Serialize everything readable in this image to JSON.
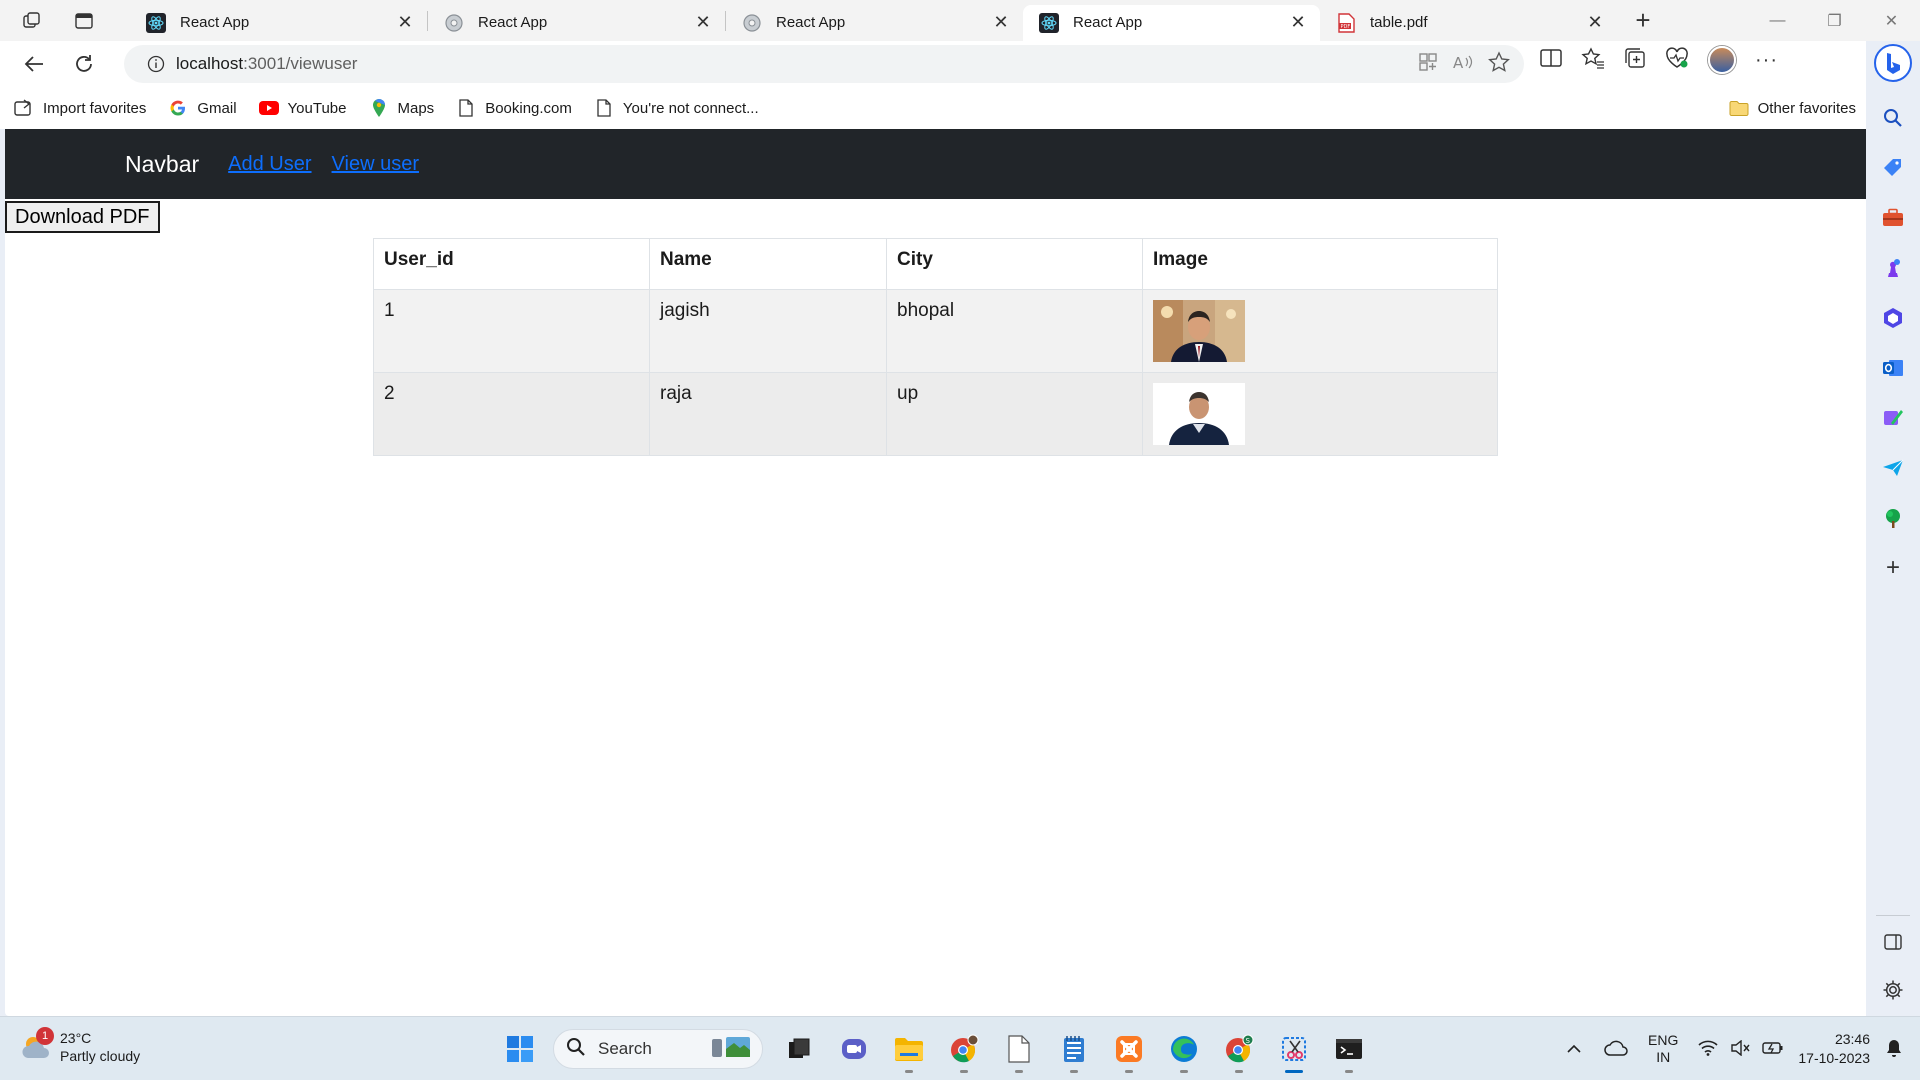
{
  "browser": {
    "tabs": [
      {
        "title": "React App",
        "favicon": "react-logo",
        "active": false
      },
      {
        "title": "React App",
        "favicon": "globe-gear",
        "active": false
      },
      {
        "title": "React App",
        "favicon": "globe-gear",
        "active": false
      },
      {
        "title": "React App",
        "favicon": "react-logo",
        "active": true
      },
      {
        "title": "table.pdf",
        "favicon": "pdf-icon",
        "active": false
      }
    ],
    "url_host": "localhost",
    "url_path": ":3001/viewuser",
    "favorites": [
      {
        "label": "Import favorites",
        "icon": "import-icon"
      },
      {
        "label": "Gmail",
        "icon": "google-icon"
      },
      {
        "label": "YouTube",
        "icon": "youtube-icon"
      },
      {
        "label": "Maps",
        "icon": "maps-pin-icon"
      },
      {
        "label": "Booking.com",
        "icon": "page-icon"
      },
      {
        "label": "You're not connect...",
        "icon": "page-icon"
      }
    ],
    "other_favorites": "Other favorites"
  },
  "page": {
    "navbar": {
      "brand": "Navbar",
      "links": [
        "Add User",
        "View user"
      ]
    },
    "download_button": "Download PDF",
    "table": {
      "headers": [
        "User_id",
        "Name",
        "City",
        "Image"
      ],
      "rows": [
        {
          "user_id": "1",
          "name": "jagish",
          "city": "bhopal",
          "image": "user-photo"
        },
        {
          "user_id": "2",
          "name": "raja",
          "city": "up",
          "image": "user-photo"
        }
      ]
    }
  },
  "taskbar": {
    "weather_badge": "1",
    "temperature": "23°C",
    "condition": "Partly cloudy",
    "search_placeholder": "Search",
    "lang_line1": "ENG",
    "lang_line2": "IN",
    "time": "23:46",
    "date": "17-10-2023"
  },
  "colors": {
    "navbar_bg": "#212529",
    "link": "#0d6efd",
    "taskbar_bg": "#dfe9f1"
  }
}
